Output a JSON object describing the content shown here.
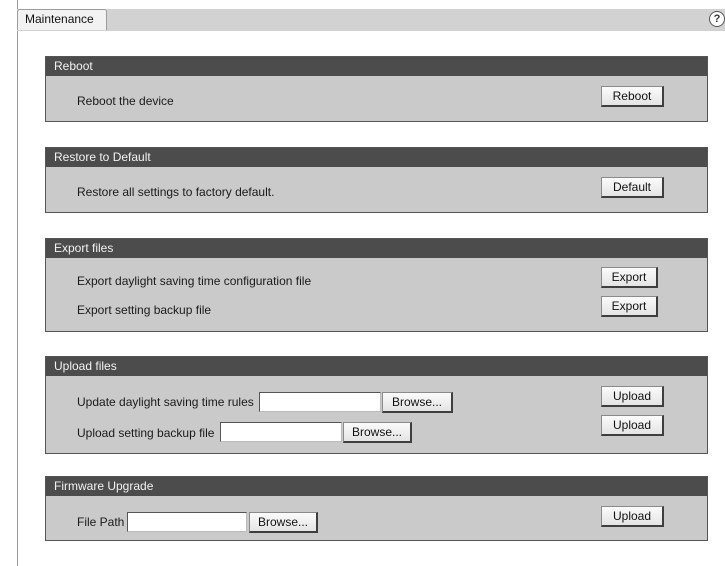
{
  "page": {
    "title": "Maintenance",
    "help_icon": "?"
  },
  "reboot": {
    "header": "Reboot",
    "description": "Reboot the device",
    "button": "Reboot"
  },
  "restore": {
    "header": "Restore to Default",
    "description": "Restore all settings to factory default.",
    "button": "Default"
  },
  "export": {
    "header": "Export files",
    "rows": [
      {
        "label": "Export daylight saving time configuration file",
        "button": "Export"
      },
      {
        "label": "Export setting backup file",
        "button": "Export"
      }
    ]
  },
  "upload": {
    "header": "Upload files",
    "rows": [
      {
        "label": "Update daylight saving time rules",
        "value": "",
        "browse": "Browse...",
        "button": "Upload"
      },
      {
        "label": "Upload setting backup file",
        "value": "",
        "browse": "Browse...",
        "button": "Upload"
      }
    ]
  },
  "firmware": {
    "header": "Firmware Upgrade",
    "label": "File Path",
    "value": "",
    "browse": "Browse...",
    "button": "Upload"
  }
}
